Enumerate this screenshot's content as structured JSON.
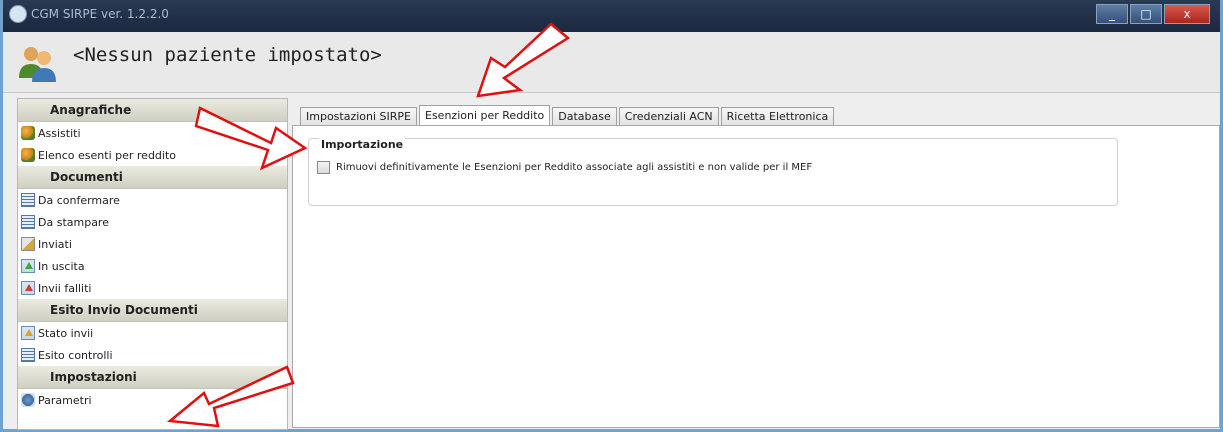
{
  "window": {
    "title": "CGM SIRPE  ver. 1.2.2.0",
    "controls": {
      "minimize": "_",
      "maximize": "□",
      "close": "x"
    }
  },
  "header": {
    "patient_title": "<Nessun paziente impostato>",
    "icon": "patients-icon"
  },
  "sidebar": {
    "sections": [
      {
        "title": "Anagrafiche",
        "items": [
          {
            "label": "Assistiti",
            "icon": "people-icon"
          },
          {
            "label": "Elenco esenti per reddito",
            "icon": "people-icon"
          }
        ]
      },
      {
        "title": "Documenti",
        "items": [
          {
            "label": "Da confermare",
            "icon": "document-icon"
          },
          {
            "label": "Da stampare",
            "icon": "document-icon"
          },
          {
            "label": "Inviati",
            "icon": "sent-icon"
          },
          {
            "label": "In uscita",
            "icon": "outgoing-icon"
          },
          {
            "label": "Invii falliti",
            "icon": "failed-icon"
          }
        ]
      },
      {
        "title": "Esito Invio Documenti",
        "items": [
          {
            "label": "Stato invii",
            "icon": "status-icon"
          },
          {
            "label": "Esito controlli",
            "icon": "document-icon"
          }
        ]
      },
      {
        "title": "Impostazioni",
        "items": [
          {
            "label": "Parametri",
            "icon": "settings-icon"
          }
        ]
      }
    ]
  },
  "tabs": [
    {
      "label": "Impostazioni SIRPE",
      "active": false
    },
    {
      "label": "Esenzioni per Reddito",
      "active": true
    },
    {
      "label": "Database",
      "active": false
    },
    {
      "label": "Credenziali ACN",
      "active": false
    },
    {
      "label": "Ricetta Elettronica",
      "active": false
    }
  ],
  "panel": {
    "group_title": "Importazione",
    "checkbox_label": "Rimuovi definitivamente le Esenzioni per Reddito associate agli assistiti e non valide per il MEF",
    "checkbox_checked": false
  },
  "colors": {
    "arrow_stroke": "#e01010",
    "titlebar": "#1f2d44",
    "window_border": "#6fa2cf"
  }
}
